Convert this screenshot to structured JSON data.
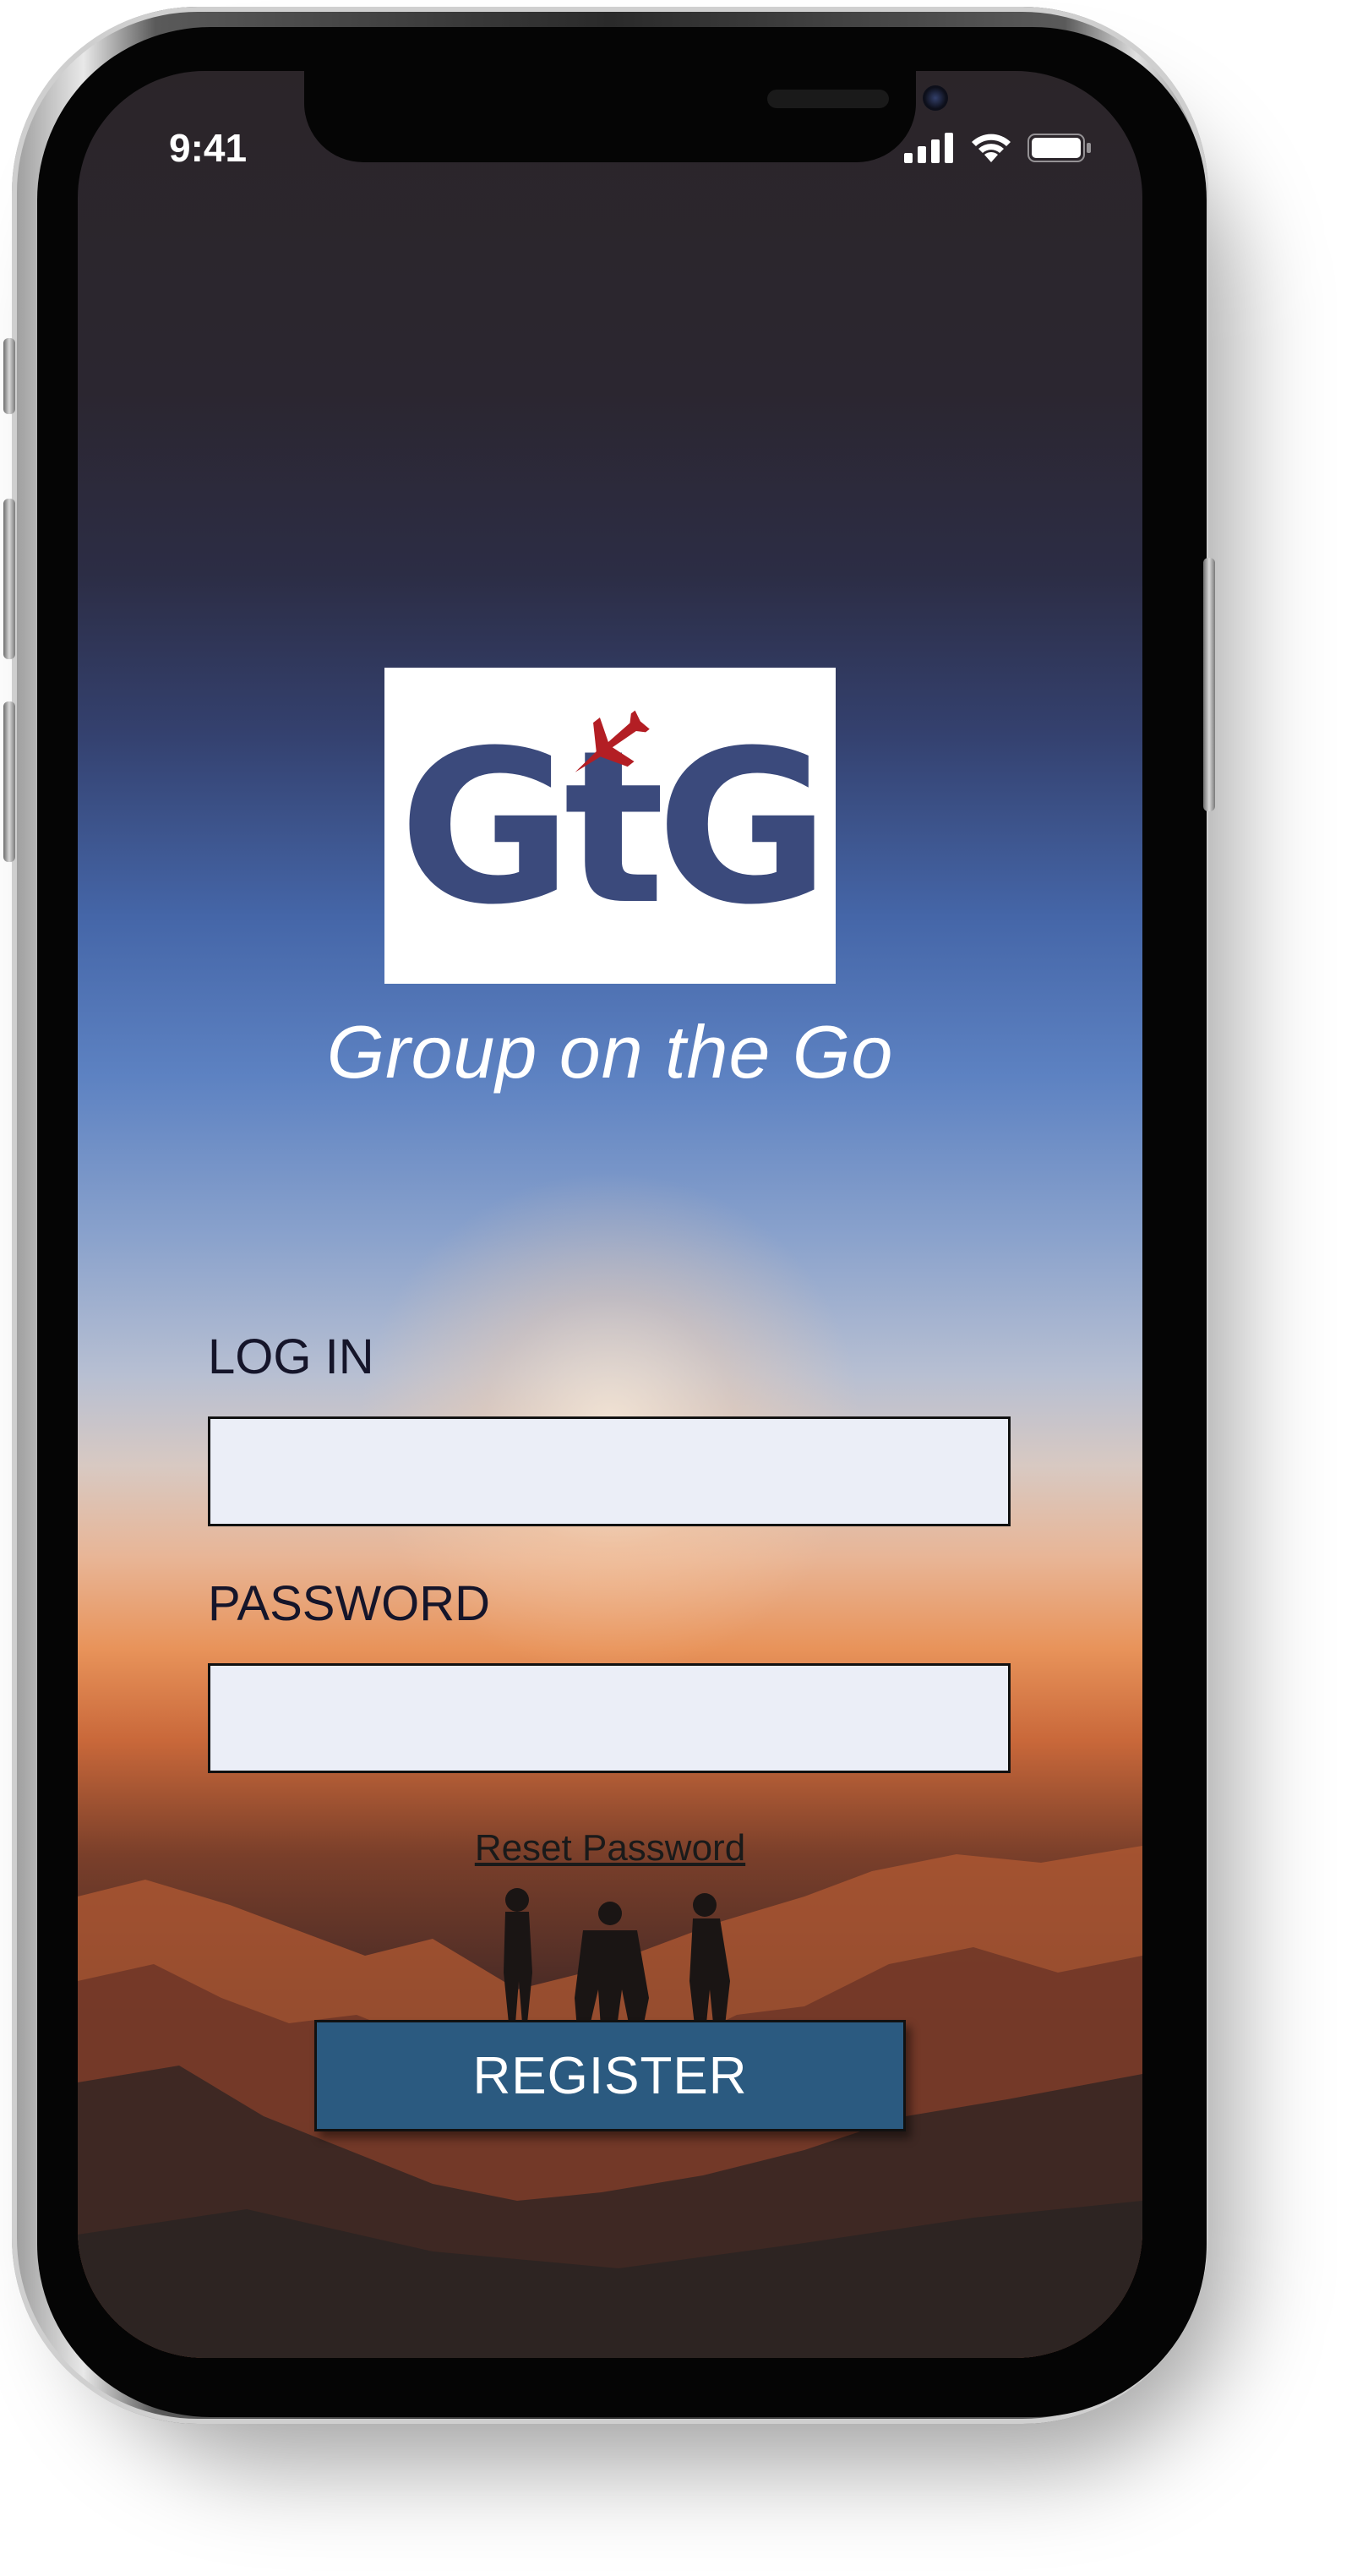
{
  "status_bar": {
    "time": "9:41",
    "icons": [
      "signal-icon",
      "wifi-icon",
      "battery-icon"
    ]
  },
  "logo": {
    "text": "GtG",
    "icon": "airplane-icon",
    "text_color": "#3b4a7c",
    "plane_color": "#b31e24"
  },
  "tagline": "Group on the Go",
  "login_form": {
    "login_label": "LOG IN",
    "login_value": "",
    "password_label": "PASSWORD",
    "password_value": "",
    "reset_link": "Reset Password",
    "register_button": "REGISTER"
  },
  "colors": {
    "input_background": "#ebeef7",
    "button_background": "#2b5a80",
    "label_text": "#15152a"
  }
}
